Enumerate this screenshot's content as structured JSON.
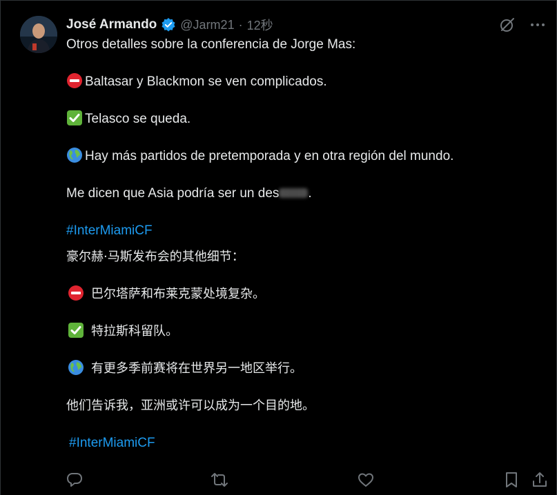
{
  "tweet": {
    "author_name": "José Armando",
    "handle": "@Jarm21",
    "separator": "·",
    "time": "12秒",
    "lines": [
      {
        "text": "Otros detalles sobre la conferencia de Jorge Mas:"
      },
      {
        "emoji": "no-entry-emoji",
        "text": "Baltasar y Blackmon se ven complicados."
      },
      {
        "emoji": "check-mark-emoji",
        "text": "Telasco se queda."
      },
      {
        "emoji": "globe-emoji",
        "text": "Hay más partidos de pretemporada y en otra región del mundo."
      },
      {
        "text": "Me dicen que Asia podría ser un des",
        "suffix": "."
      },
      {
        "text": "#InterMiamiCF"
      },
      {
        "text": "豪尔赫·马斯发布会的其他细节："
      },
      {
        "emoji": "no-entry-emoji",
        "text": "巴尔塔萨和布莱克蒙处境复杂。"
      },
      {
        "emoji": "check-mark-emoji",
        "text": "特拉斯科留队。"
      },
      {
        "emoji": "globe-emoji",
        "text": "有更多季前赛将在世界另一地区举行。"
      },
      {
        "text": "他们告诉我，亚洲或许可以成为一个目的地。"
      },
      {
        "text": "#InterMiamiCF"
      }
    ]
  },
  "icons": {
    "verified": "verified-badge-icon",
    "grok": "grok-icon",
    "more": "more-icon",
    "reply": "reply-icon",
    "retweet": "retweet-icon",
    "like": "like-icon",
    "bookmark": "bookmark-icon",
    "share": "share-icon"
  },
  "colors": {
    "background": "#000000",
    "text": "#e7e9ea",
    "muted": "#71767b",
    "link": "#1d9bf0",
    "verified": "#1d9bf0"
  }
}
